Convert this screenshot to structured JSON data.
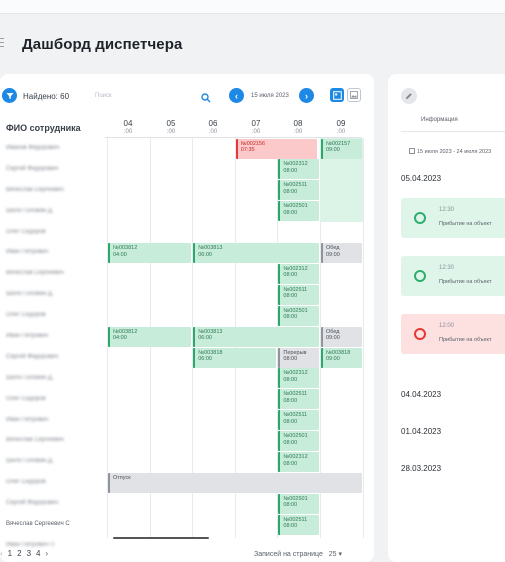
{
  "page": {
    "title": "Дашборд диспетчера"
  },
  "toolbar": {
    "found": "Найдено: 60",
    "search_placeholder": "Поиск",
    "date": "15 июля 2023",
    "prev": "‹",
    "next": "›"
  },
  "table": {
    "name_header": "ФИО сотрудника",
    "hours": [
      {
        "h": "04",
        "m": ":00"
      },
      {
        "h": "05",
        "m": ":00"
      },
      {
        "h": "06",
        "m": ":00"
      },
      {
        "h": "07",
        "m": ":00"
      },
      {
        "h": "08",
        "m": ":00"
      },
      {
        "h": "09",
        "m": ":00"
      }
    ],
    "names": [
      "Иванов Федорович",
      "Сергей Федорович",
      "Вячеслав Сергеевич",
      "Шило Головин Д.",
      "Олег Сидоров",
      "Иван Петрович",
      "Вячеслав Сергеевич",
      "Шило Головин Д.",
      "Олег Сидоров",
      "Иван Петрович",
      "Сергей Федорович",
      "Шило Головин Д.",
      "Олег Сидоров",
      "Иван Петрович",
      "Вячеслав Сергеевич",
      "Шило Головин Д.",
      "Олег Сидоров",
      "Сергей Федорович",
      "Вячеслав Сергеевич С",
      "Иван Петрович П"
    ],
    "rows": [
      [
        {
          "t": "red",
          "c": 3,
          "s": 1.95,
          "l1": "№002156",
          "l2": "07:35"
        },
        {
          "t": "green",
          "c": 5,
          "s": 1,
          "l1": "№002157",
          "l2": "09:00"
        }
      ],
      [
        {
          "t": "green",
          "c": 4,
          "s": 1,
          "l1": "№002312",
          "l2": "08:00"
        }
      ],
      [
        {
          "t": "green",
          "c": 4,
          "s": 1,
          "l1": "№002511",
          "l2": "08:00"
        }
      ],
      [
        {
          "t": "green",
          "c": 4,
          "s": 1,
          "l1": "№002501",
          "l2": "08:00"
        }
      ],
      [],
      [
        {
          "t": "green",
          "c": 0,
          "s": 2,
          "l1": "№003812",
          "l2": "04:00"
        },
        {
          "t": "green",
          "c": 2,
          "s": 3,
          "l1": "№003813",
          "l2": "06:00"
        },
        {
          "t": "grey",
          "c": 5,
          "s": 1,
          "l1": "Обед",
          "l2": "09:00"
        }
      ],
      [
        {
          "t": "green",
          "c": 4,
          "s": 1,
          "l1": "№002312",
          "l2": "08:00"
        }
      ],
      [
        {
          "t": "green",
          "c": 4,
          "s": 1,
          "l1": "№002511",
          "l2": "08:00"
        }
      ],
      [
        {
          "t": "green",
          "c": 4,
          "s": 1,
          "l1": "№002501",
          "l2": "08:00"
        }
      ],
      [
        {
          "t": "green",
          "c": 0,
          "s": 2,
          "l1": "№003812",
          "l2": "04:00"
        },
        {
          "t": "green",
          "c": 2,
          "s": 3,
          "l1": "№003813",
          "l2": "06:00"
        },
        {
          "t": "grey",
          "c": 5,
          "s": 1,
          "l1": "Обед",
          "l2": "09:00"
        }
      ],
      [
        {
          "t": "green",
          "c": 2,
          "s": 2,
          "l1": "№003818",
          "l2": "06:00"
        },
        {
          "t": "grey",
          "c": 4,
          "s": 1,
          "l1": "Перерыв",
          "l2": "08:00"
        },
        {
          "t": "green",
          "c": 5,
          "s": 1,
          "l1": "№003818",
          "l2": "09:00"
        }
      ],
      [
        {
          "t": "green",
          "c": 4,
          "s": 1,
          "l1": "№002312",
          "l2": "08:00"
        }
      ],
      [
        {
          "t": "green",
          "c": 4,
          "s": 1,
          "l1": "№002511",
          "l2": "08:00"
        }
      ],
      [
        {
          "t": "green",
          "c": 4,
          "s": 1,
          "l1": "№002511",
          "l2": "08:00"
        }
      ],
      [
        {
          "t": "green",
          "c": 4,
          "s": 1,
          "l1": "№002501",
          "l2": "08:00"
        }
      ],
      [
        {
          "t": "green",
          "c": 4,
          "s": 1,
          "l1": "№002312",
          "l2": "08:00"
        }
      ],
      [
        {
          "t": "grey",
          "c": 0,
          "s": 6,
          "l1": "Отпуск",
          "l2": ""
        }
      ],
      [
        {
          "t": "green",
          "c": 4,
          "s": 1,
          "l1": "№002501",
          "l2": "08:00"
        }
      ],
      [
        {
          "t": "green",
          "c": 4,
          "s": 1,
          "l1": "№002511",
          "l2": "08:00"
        }
      ]
    ]
  },
  "pagination": {
    "pages": [
      "1",
      "2",
      "3",
      "4"
    ],
    "per_page_label": "Записей на странице",
    "per_page_value": "25 ▾"
  },
  "info": {
    "tab": "Информация",
    "range": "15 июля 2023 - 24 июля 2023",
    "dates": [
      "05.04.2023",
      "04.04.2023",
      "01.04.2023",
      "28.03.2023"
    ],
    "events": [
      {
        "time": "12:30",
        "text": "Прибытие на объект",
        "status": "green"
      },
      {
        "time": "12:30",
        "text": "Прибытие на объект",
        "status": "green"
      },
      {
        "time": "12:00",
        "text": "Прибытие на объект",
        "status": "red"
      }
    ]
  },
  "colors": {
    "accent": "#1e88e5",
    "ok": "#29a86b",
    "error": "#e53935"
  }
}
